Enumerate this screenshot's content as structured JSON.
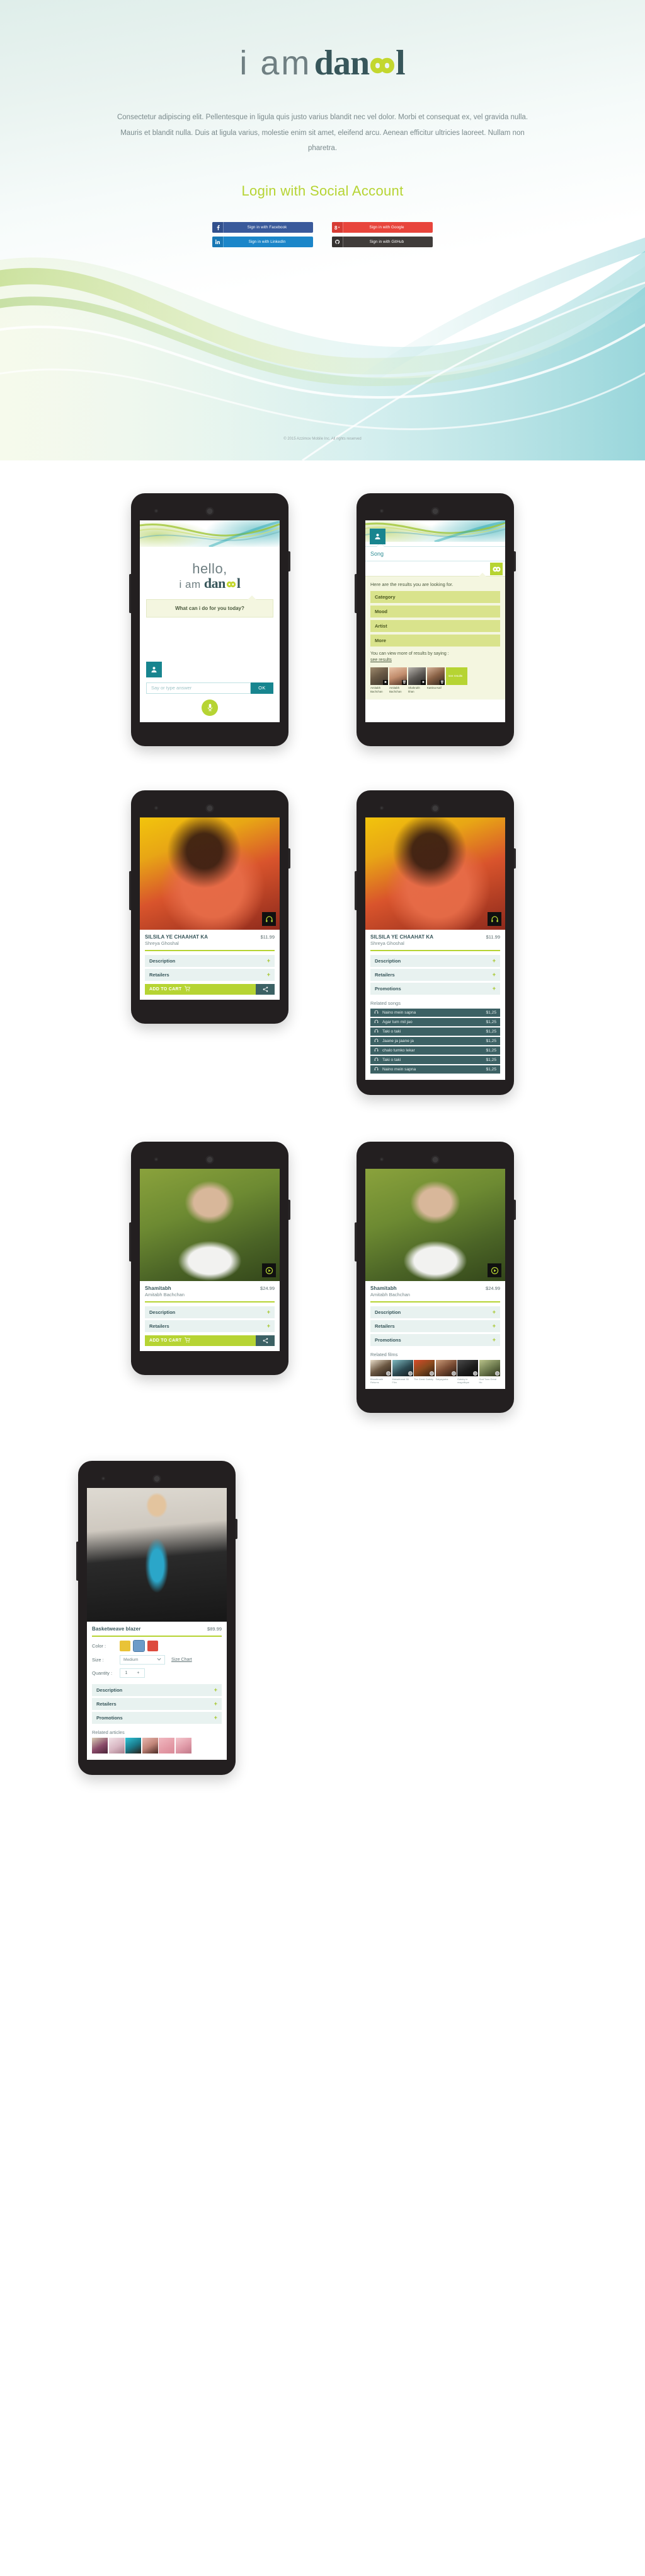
{
  "hero": {
    "logo": {
      "prefix": "i am",
      "word": "dan",
      "suffix": "l",
      "oo_icon": "infinity-loop-icon"
    },
    "description": "Consectetur adipiscing elit. Pellentesque in ligula quis justo varius blandit nec vel dolor. Morbi et consequat ex, vel gravida nulla. Mauris et blandit nulla. Duis at ligula varius, molestie enim sit amet, eleifend arcu. Aenean efficitur ultricies laoreet. Nullam non pharetra.",
    "login_title": "Login with Social Account",
    "social_buttons": [
      {
        "id": "facebook",
        "label": "Sign in with Facebook",
        "icon": "facebook-icon",
        "color": "#3a5a9b"
      },
      {
        "id": "google",
        "label": "Sign in with Google",
        "icon": "google-plus-icon",
        "color": "#e8453c"
      },
      {
        "id": "linkedin",
        "label": "Sign in with LinkedIn",
        "icon": "linkedin-icon",
        "color": "#1b86c9"
      },
      {
        "id": "github",
        "label": "Sign in with GitHub",
        "icon": "github-icon",
        "color": "#403c3a"
      }
    ],
    "copyright": "© 2015 Azzimov Mobile Inc. All rights reserved"
  },
  "screen_hello": {
    "greeting_line1": "hello,",
    "greeting_line2": "i am",
    "greeting_brand": "dan",
    "greeting_brand_end": "l",
    "bubble": "What can i do for you today?",
    "input_placeholder": "Say or type answer",
    "ok_label": "OK",
    "mic_icon": "microphone-icon",
    "avatar_icon": "user-icon"
  },
  "screen_results": {
    "query": "Song",
    "lead": "Here are the results you are looking for.",
    "facets": [
      "Category",
      "Mood",
      "Artist",
      "More"
    ],
    "more_line1": "You can view more of results by saying :",
    "more_link": "see results",
    "people": [
      {
        "name": "Amitabh Bachchan",
        "badge": "✖"
      },
      {
        "name": "Amitabh Bachchan",
        "badge": "🗑"
      },
      {
        "name": "Shahrukh khan",
        "badge": "✖"
      },
      {
        "name": "Katrina Kaif",
        "badge": "🗑"
      }
    ],
    "see_results_tile": "see results",
    "avatar_icon": "user-icon",
    "bot_icon": "daneel-mark-icon"
  },
  "screen_song": {
    "title": "SILSILA YE CHAAHAT KA",
    "artist": "Shreya Ghoshal",
    "price": "$11.99",
    "media_icon": "headphones-icon",
    "accordion": [
      "Description",
      "Retailers"
    ],
    "cart_label": "ADD TO CART",
    "cart_icon": "cart-icon",
    "share_icon": "share-icon"
  },
  "screen_song_expanded": {
    "title": "SILSILA YE CHAAHAT KA",
    "artist": "Shreya Ghoshal",
    "price": "$11.99",
    "media_icon": "headphones-icon",
    "accordion": [
      "Description",
      "Retailers",
      "Promotions"
    ],
    "related_label": "Related songs",
    "related_songs": [
      {
        "name": "Naino mein sapna",
        "price": "$1,25"
      },
      {
        "name": "Agar tum mil jao",
        "price": "$1,25"
      },
      {
        "name": "Taki o taki",
        "price": "$1,25"
      },
      {
        "name": "Jaane ja jaane ja",
        "price": "$1,25"
      },
      {
        "name": "chalo tumko lekar",
        "price": "$1,25"
      },
      {
        "name": "Taki o taki",
        "price": "$1,25"
      },
      {
        "name": "Naino mein sapna",
        "price": "$1,25"
      }
    ],
    "row_icon": "headphones-icon"
  },
  "screen_film": {
    "title": "Shamitabh",
    "artist": "Amitabh Bachchan",
    "price": "$24.99",
    "media_icon": "play-icon",
    "accordion": [
      "Description",
      "Retailers"
    ],
    "cart_label": "ADD TO CART",
    "cart_icon": "cart-icon",
    "share_icon": "share-icon"
  },
  "screen_film_expanded": {
    "title": "Shamitabh",
    "artist": "Amitabh Bachchan",
    "price": "$24.99",
    "media_icon": "play-icon",
    "accordion": [
      "Description",
      "Retailers",
      "Promotions"
    ],
    "related_label": "Related films",
    "related_films": [
      "Bhoothnath Returns",
      "Mahabharat 3D Film",
      "The Great Gatsby",
      "Satyagraha",
      "Gatsby le magnifique",
      "God Tuss Great Ho"
    ],
    "film_badge_icon": "play-circle-icon"
  },
  "screen_fashion": {
    "title": "Basketweave blazer",
    "price": "$89.99",
    "color_label": "Color :",
    "colors": [
      "#e9c337",
      "#6c9bc8",
      "#dd4b3e"
    ],
    "size_label": "Size :",
    "size_value": "Medium",
    "size_chart_label": "Size Chart",
    "quantity_label": "Quantity :",
    "quantity_value": "1",
    "quantity_plus": "+",
    "accordion": [
      "Description",
      "Retailers",
      "Promotions"
    ],
    "related_label": "Related articles",
    "related_count": 6,
    "chevron_icon": "chevron-down-icon"
  },
  "theme": {
    "green": "#b6d433",
    "teal": "#18858f",
    "dark_teal": "#3c6164",
    "pale_green": "#f4f6e0",
    "pale_teal": "#e8f2f0"
  }
}
